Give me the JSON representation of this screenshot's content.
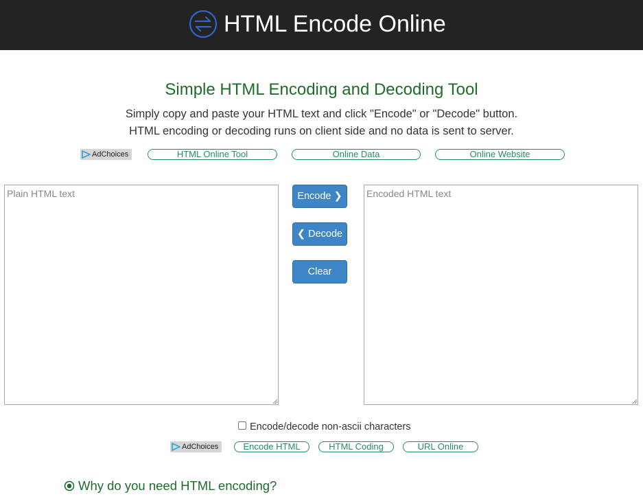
{
  "header": {
    "logo_icon": "arrows-exchange-circle-icon",
    "site_title": "HTML Encode Online"
  },
  "main": {
    "title": "Simple HTML Encoding and Decoding Tool",
    "description_line1": "Simply copy and paste your HTML text and click \"Encode\" or \"Decode\" button.",
    "description_line2": "HTML encoding or decoding runs on client side and no data is sent to server."
  },
  "ad_bar_top": {
    "adchoices_label": "AdChoices",
    "links": [
      "HTML Online Tool",
      "Online Data",
      "Online Website"
    ]
  },
  "editor": {
    "plain_placeholder": "Plain HTML text",
    "plain_value": "",
    "encoded_placeholder": "Encoded HTML text",
    "encoded_value": "",
    "encode_label": "Encode ❯",
    "decode_label": "❮ Decode",
    "clear_label": "Clear",
    "non_ascii_label": "Encode/decode non-ascii characters",
    "non_ascii_checked": false
  },
  "ad_bar_bottom": {
    "adchoices_label": "AdChoices",
    "links": [
      "Encode HTML",
      "HTML Coding",
      "URL Online"
    ]
  },
  "faq": {
    "question_icon": "radio-target-icon",
    "question": "Why do you need HTML encoding?"
  },
  "colors": {
    "header_bg": "#232323",
    "title_green": "#1f6b2a",
    "button_blue": "#3d85c6",
    "pill_green": "#2a8a67"
  }
}
